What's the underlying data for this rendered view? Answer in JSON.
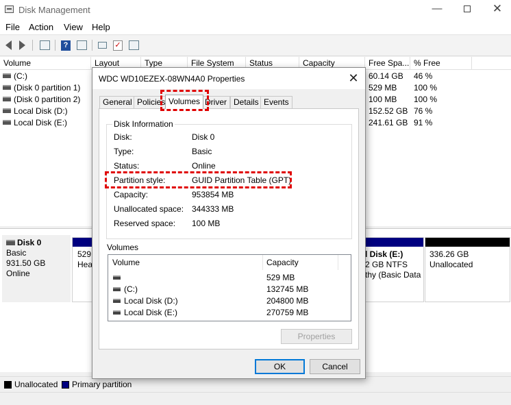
{
  "window": {
    "title": "Disk Management",
    "minimize": "—",
    "close": "✕"
  },
  "menu": [
    "File",
    "Action",
    "View",
    "Help"
  ],
  "toolbar_icons": [
    "back-icon",
    "forward-icon",
    "console-tree-icon",
    "help-icon",
    "properties-icon",
    "connect-icon",
    "check-icon",
    "export-icon"
  ],
  "volume_list": {
    "columns": [
      "Volume",
      "Layout",
      "Type",
      "File System",
      "Status",
      "Capacity",
      "Free Spa...",
      "% Free"
    ],
    "rows": [
      {
        "name": "(C:)",
        "free": "60.14 GB",
        "pct": "46 %"
      },
      {
        "name": "(Disk 0 partition 1)",
        "free": "529 MB",
        "pct": "100 %"
      },
      {
        "name": "(Disk 0 partition 2)",
        "free": "100 MB",
        "pct": "100 %"
      },
      {
        "name": "Local Disk (D:)",
        "free": "152.52 GB",
        "pct": "76 %"
      },
      {
        "name": "Local Disk (E:)",
        "free": "241.61 GB",
        "pct": "91 %"
      }
    ]
  },
  "disk_view": {
    "disk_name": "Disk 0",
    "disk_type": "Basic",
    "disk_size": "931.50 GB",
    "disk_status": "Online",
    "partition_left": {
      "line1": "529",
      "line2": "Hea"
    },
    "partition_e": {
      "line1": "l Disk  (E:)",
      "line2": "2 GB NTFS",
      "line3": "thy (Basic Data"
    },
    "unallocated": {
      "line1": "336.26 GB",
      "line2": "Unallocated"
    }
  },
  "legend": [
    {
      "label": "Unallocated",
      "color": "#000000"
    },
    {
      "label": "Primary partition",
      "color": "#000080"
    }
  ],
  "dialog": {
    "title": "WDC WD10EZEX-08WN4A0 Properties",
    "close": "✕",
    "tabs": [
      "General",
      "Policies",
      "Volumes",
      "Driver",
      "Details",
      "Events"
    ],
    "active_tab": "Volumes",
    "disk_info_title": "Disk Information",
    "info": [
      {
        "label": "Disk:",
        "value": "Disk 0"
      },
      {
        "label": "Type:",
        "value": "Basic"
      },
      {
        "label": "Status:",
        "value": "Online"
      },
      {
        "label": "Partition style:",
        "value": "GUID Partition Table (GPT)"
      },
      {
        "label": "Capacity:",
        "value": "953854 MB"
      },
      {
        "label": "Unallocated space:",
        "value": "344333 MB"
      },
      {
        "label": "Reserved space:",
        "value": "100 MB"
      }
    ],
    "volumes_title": "Volumes",
    "volumes_columns": [
      "Volume",
      "Capacity"
    ],
    "volumes": [
      {
        "name": "",
        "capacity": "529 MB"
      },
      {
        "name": "(C:)",
        "capacity": "132745 MB"
      },
      {
        "name": "Local Disk (D:)",
        "capacity": "204800 MB"
      },
      {
        "name": "Local Disk (E:)",
        "capacity": "270759 MB"
      }
    ],
    "properties_button": "Properties",
    "ok_button": "OK",
    "cancel_button": "Cancel"
  },
  "colors": {
    "primary_partition": "#000080",
    "unallocated": "#000000",
    "highlight": "#e00000"
  }
}
